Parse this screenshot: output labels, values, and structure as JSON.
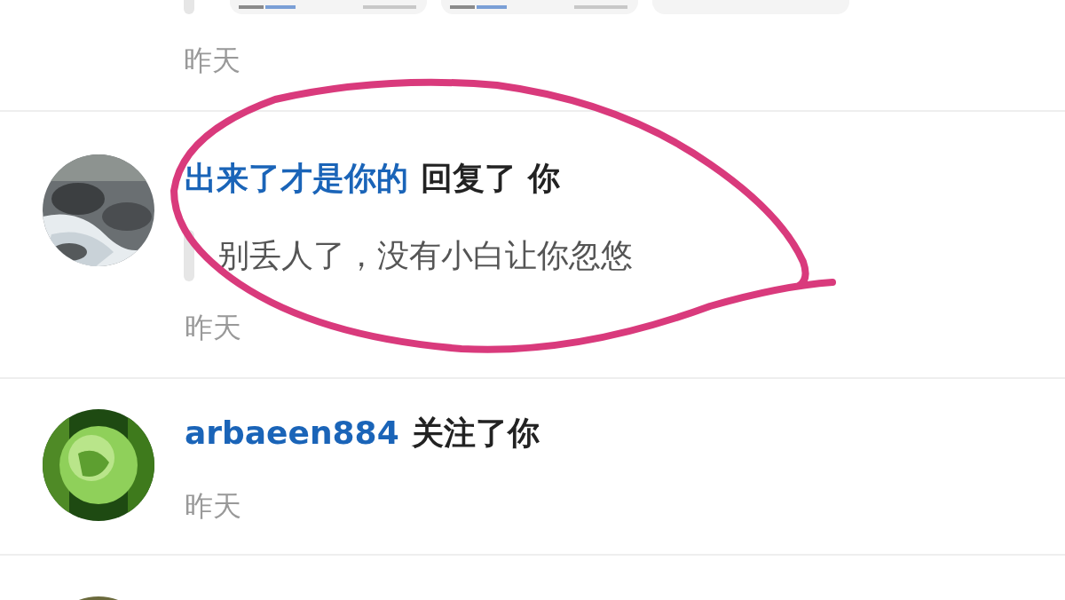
{
  "notifications": [
    {
      "kind": "images",
      "images": [
        {
          "kind": "screenshot"
        },
        {
          "kind": "screenshot"
        },
        {
          "kind": "blank"
        }
      ],
      "time": "昨天"
    },
    {
      "kind": "reply",
      "user": "出来了才是你的",
      "action": "回复了 你",
      "quote": "别丢人了，没有小白让你忽悠",
      "time": "昨天"
    },
    {
      "kind": "follow",
      "user": "arbaeen884",
      "action": "关注了你",
      "time": "昨天"
    },
    {
      "kind": "cut"
    }
  ]
}
